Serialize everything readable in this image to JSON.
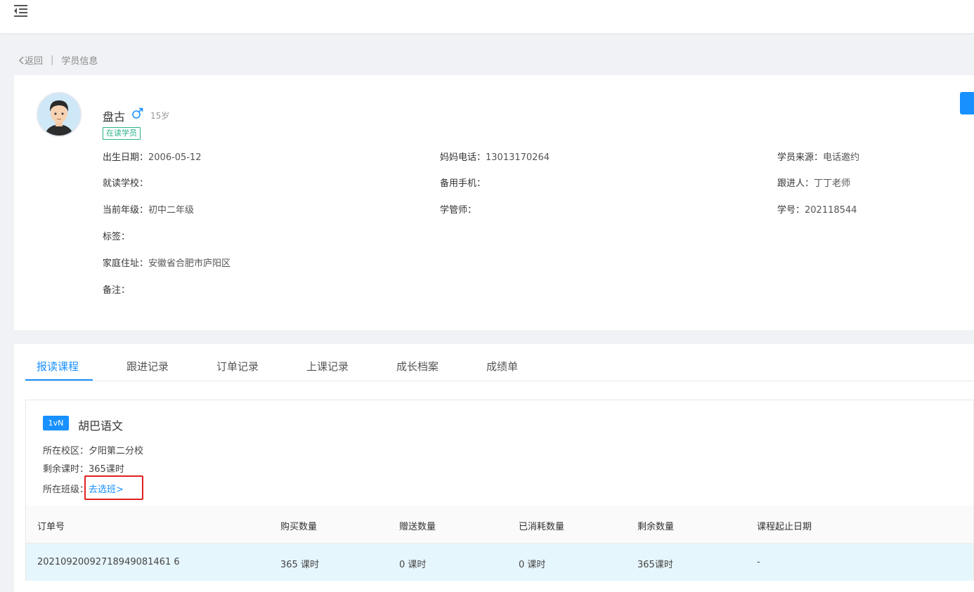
{
  "breadcrumb": {
    "back_label": "返回",
    "separator": "|",
    "current": "学员信息"
  },
  "student": {
    "name": "盘古",
    "age": "15岁",
    "status": "在读学员",
    "fields": [
      {
        "label": "出生日期：",
        "value": "2006-05-12"
      },
      {
        "label": "妈妈电话：",
        "value": "13013170264"
      },
      {
        "label": "学员来源：",
        "value": "电话邀约"
      },
      {
        "label": "就读学校：",
        "value": ""
      },
      {
        "label": "备用手机：",
        "value": ""
      },
      {
        "label": "跟进人：",
        "value": "丁丁老师"
      },
      {
        "label": "当前年级：",
        "value": "初中二年级"
      },
      {
        "label": "学管师：",
        "value": ""
      },
      {
        "label": "学号：",
        "value": "202118544"
      },
      {
        "label": "标签：",
        "value": ""
      },
      {
        "label": "家庭住址：",
        "value": "安徽省合肥市庐阳区"
      },
      {
        "label": "备注：",
        "value": ""
      }
    ]
  },
  "tabs": [
    {
      "label": "报读课程"
    },
    {
      "label": "跟进记录"
    },
    {
      "label": "订单记录"
    },
    {
      "label": "上课记录"
    },
    {
      "label": "成长档案"
    },
    {
      "label": "成绩单"
    }
  ],
  "course": {
    "type_badge": "1vN",
    "name": "胡巴语文",
    "campus_label": "所在校区：",
    "campus": "夕阳第二分校",
    "remaining_label": "剩余课时：",
    "remaining": "365课时",
    "class_label": "所在班级：",
    "select_class": "去选班>"
  },
  "table": {
    "headers": [
      "订单号",
      "购买数量",
      "赠送数量",
      "已消耗数量",
      "剩余数量",
      "课程起止日期"
    ],
    "rows": [
      [
        "20210920092718949081461 6",
        "365 课时",
        "0 课时",
        "0 课时",
        "365课时",
        "-"
      ]
    ]
  },
  "colors": {
    "primary": "#1890ff",
    "status_green": "#2bb38a",
    "highlight_red": "#e02020",
    "row_highlight": "#e6f6fd"
  }
}
